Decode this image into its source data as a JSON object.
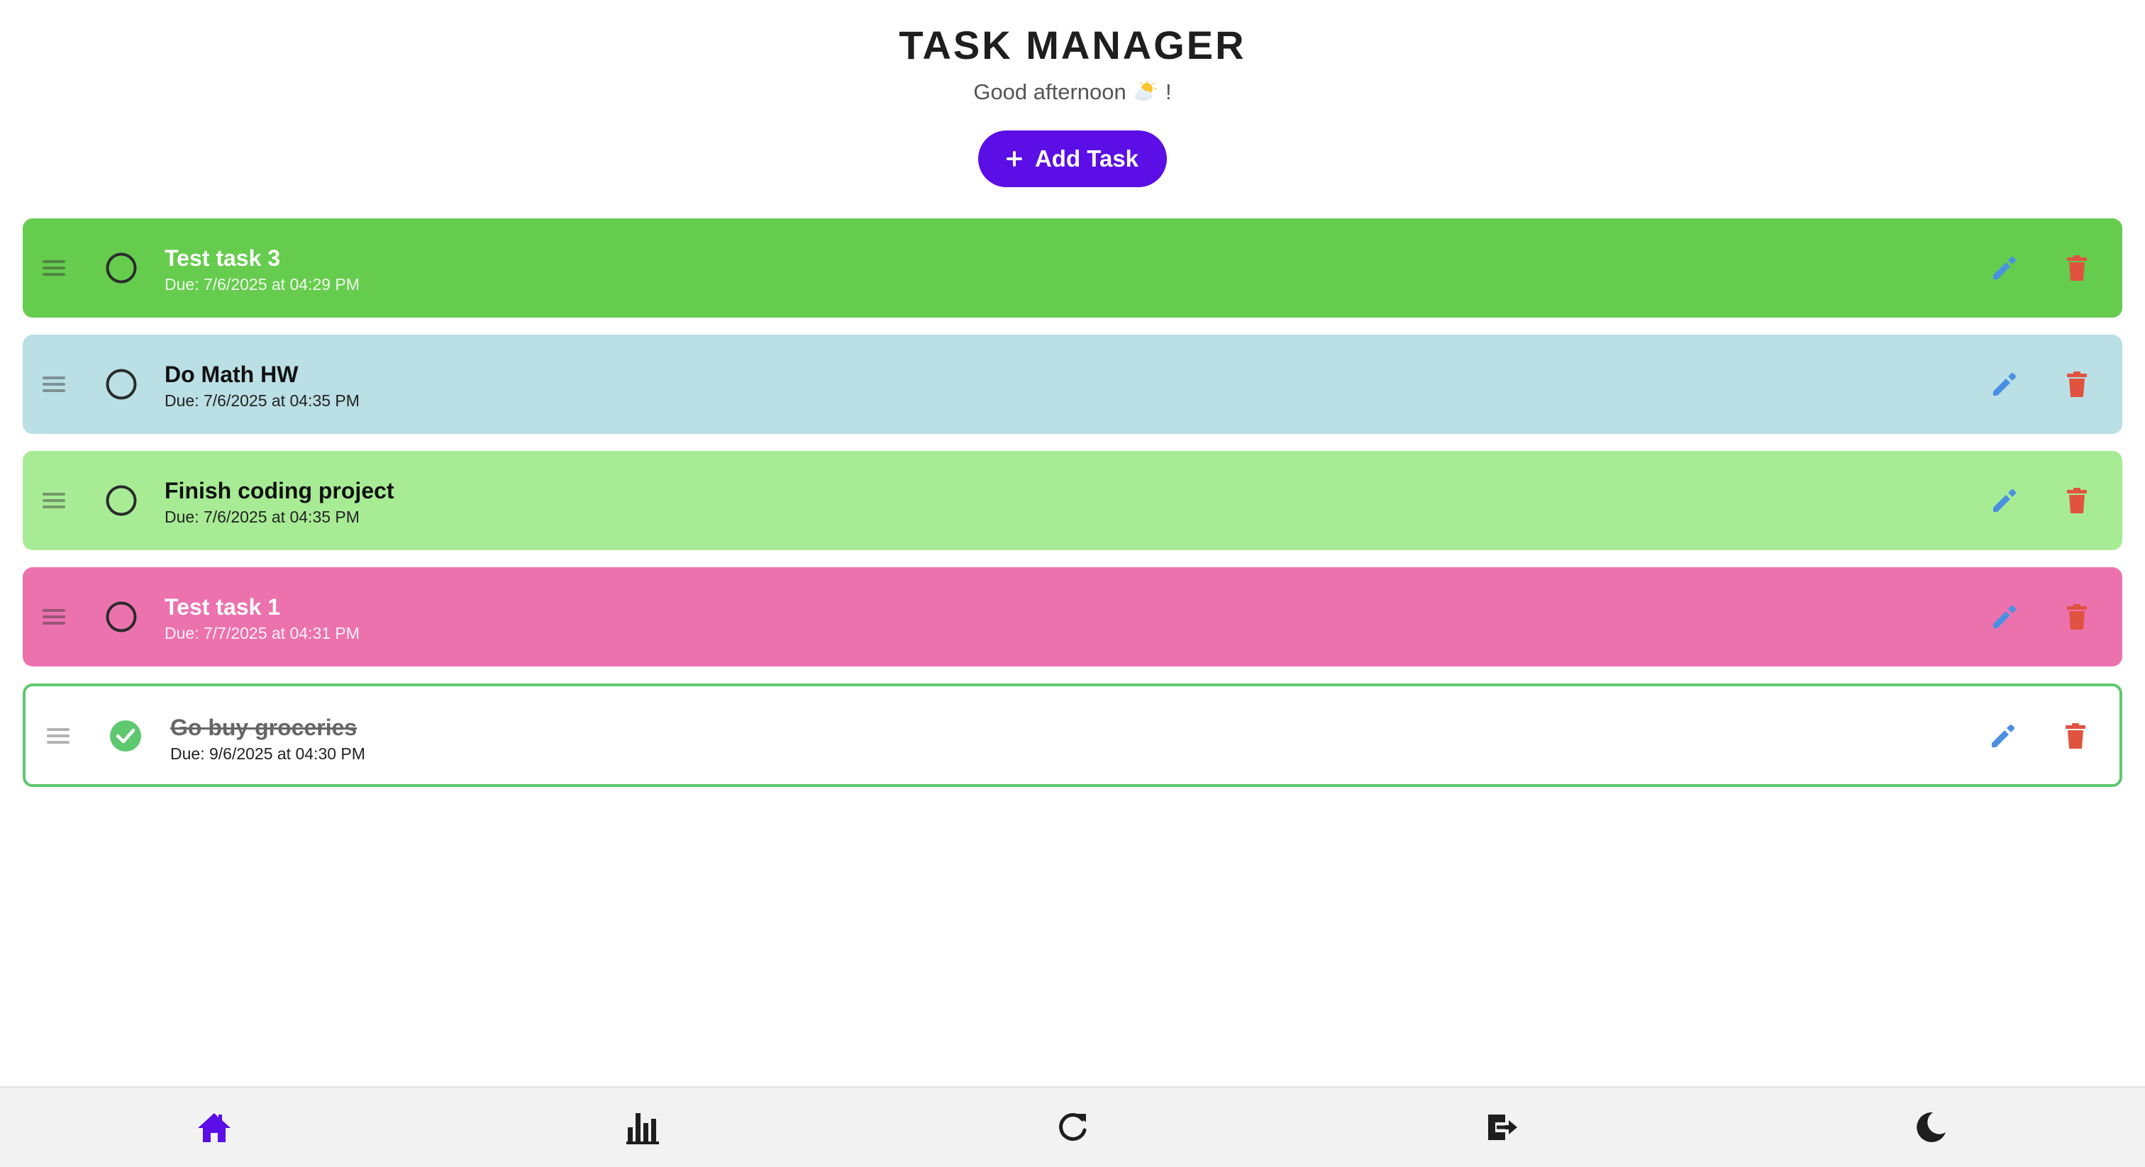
{
  "header": {
    "title": "TASK MANAGER",
    "greeting_prefix": "Good afternoon",
    "greeting_suffix": "!",
    "greeting_icon": "sun-behind-cloud-emoji"
  },
  "add_button": {
    "label": "Add Task",
    "icon": "plus-icon",
    "color": "#5b0ee6"
  },
  "tasks": [
    {
      "name": "Test task 3",
      "due": "Due: 7/6/2025 at 04:29 PM",
      "completed": false,
      "bg": "#66cc4e",
      "text_color": "#ffffff"
    },
    {
      "name": "Do Math HW",
      "due": "Due: 7/6/2025 at 04:35 PM",
      "completed": false,
      "bg": "#badfe5",
      "text_color": "#111111"
    },
    {
      "name": "Finish coding project",
      "due": "Due: 7/6/2025 at 04:35 PM",
      "completed": false,
      "bg": "#a7ec95",
      "text_color": "#111111"
    },
    {
      "name": "Test task 1",
      "due": "Due: 7/7/2025 at 04:31 PM",
      "completed": false,
      "bg": "#ec72ae",
      "text_color": "#ffffff"
    },
    {
      "name": "Go buy groceries",
      "due": "Due: 9/6/2025 at 04:30 PM",
      "completed": true,
      "bg": "#ffffff",
      "text_color": "#111111",
      "border": "#5ec86f"
    }
  ],
  "task_actions": {
    "edit_icon": "pencil-icon",
    "delete_icon": "trash-icon",
    "edit_color": "#4a90e2",
    "delete_color": "#e0533f",
    "drag_icon": "drag-handle-icon"
  },
  "bottom_nav": {
    "items": [
      {
        "name": "home",
        "icon": "home-icon",
        "active": true
      },
      {
        "name": "stats",
        "icon": "bar-chart-icon",
        "active": false
      },
      {
        "name": "refresh",
        "icon": "refresh-icon",
        "active": false
      },
      {
        "name": "logout",
        "icon": "logout-icon",
        "active": false
      },
      {
        "name": "dark-mode",
        "icon": "moon-icon",
        "active": false
      }
    ],
    "active_color": "#5b0ee6",
    "icon_color": "#1e1e1e"
  }
}
